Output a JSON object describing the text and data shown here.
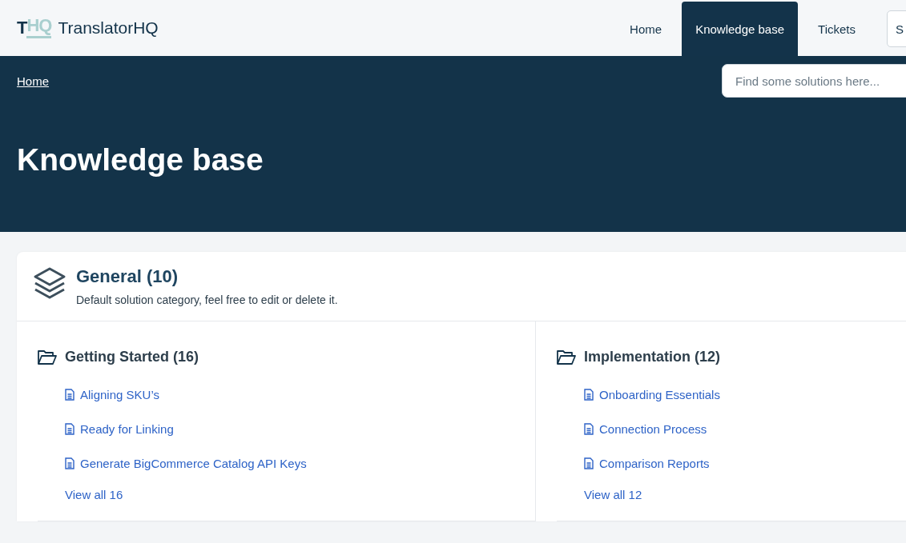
{
  "header": {
    "logo": {
      "mark_dark": "T",
      "mark_light": "HQ",
      "name": "TranslatorHQ"
    },
    "nav": [
      {
        "label": "Home",
        "selected": false
      },
      {
        "label": "Knowledge base",
        "selected": true
      },
      {
        "label": "Tickets",
        "selected": false
      }
    ],
    "cut_button": "S"
  },
  "hero": {
    "breadcrumb": "Home",
    "search": {
      "placeholder": "Find some solutions here..."
    },
    "title": "Knowledge base"
  },
  "category": {
    "title": "General (10)",
    "description": "Default solution category, feel free to edit or delete it.",
    "folders": [
      {
        "title": "Getting Started (16)",
        "articles": [
          "Aligning SKU’s",
          "Ready for Linking",
          "Generate BigCommerce Catalog API Keys"
        ],
        "view_all": "View all 16"
      },
      {
        "title": "Implementation (12)",
        "articles": [
          "Onboarding Essentials",
          "Connection Process",
          "Comparison Reports"
        ],
        "view_all": "View all 12"
      }
    ]
  }
}
